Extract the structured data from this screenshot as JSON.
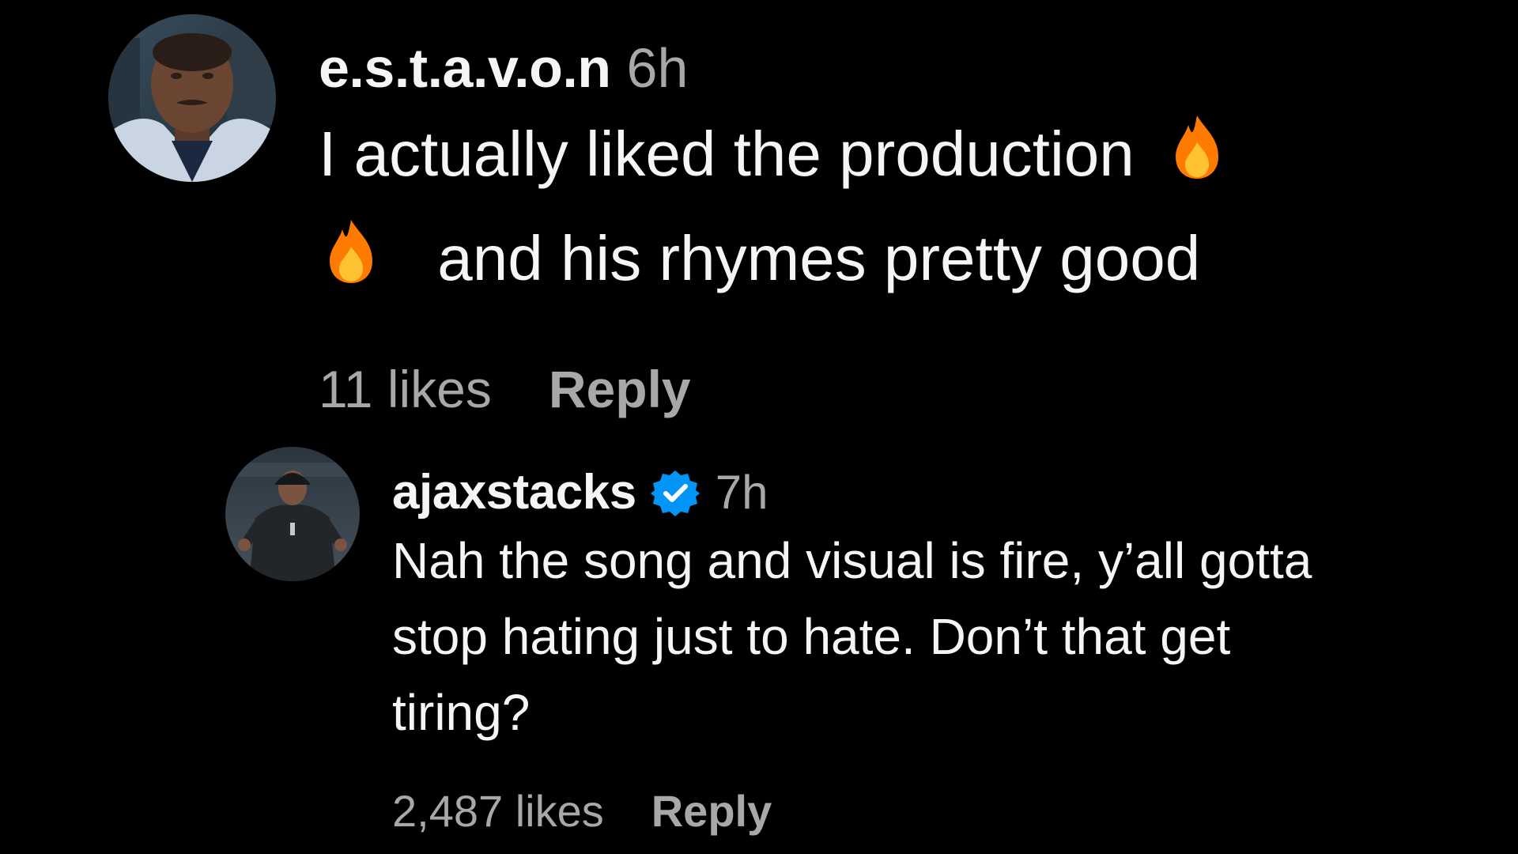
{
  "comments": [
    {
      "username": "e.s.t.a.v.o.n",
      "time": "6h",
      "text_part1": "I actually liked the production",
      "text_part2": "and his rhymes pretty good",
      "likes": "11 likes",
      "reply_label": "Reply",
      "avatar_icon": "profile-photo"
    },
    {
      "username": "ajaxstacks",
      "verified": true,
      "time": "7h",
      "text": "Nah the song and visual is fire, y’all gotta stop hating just to hate. Don’t that get tiring?",
      "likes": "2,487 likes",
      "reply_label": "Reply",
      "avatar_icon": "profile-photo"
    }
  ],
  "colors": {
    "background": "#000000",
    "primary_text": "#f5f5f5",
    "secondary_text": "#a8a8a8",
    "verified_badge": "#0095f6",
    "fire_outer": "#ff7a00",
    "fire_inner": "#ffc233"
  },
  "icons": {
    "fire": "fire-emoji-icon",
    "verified": "verified-badge-icon"
  }
}
